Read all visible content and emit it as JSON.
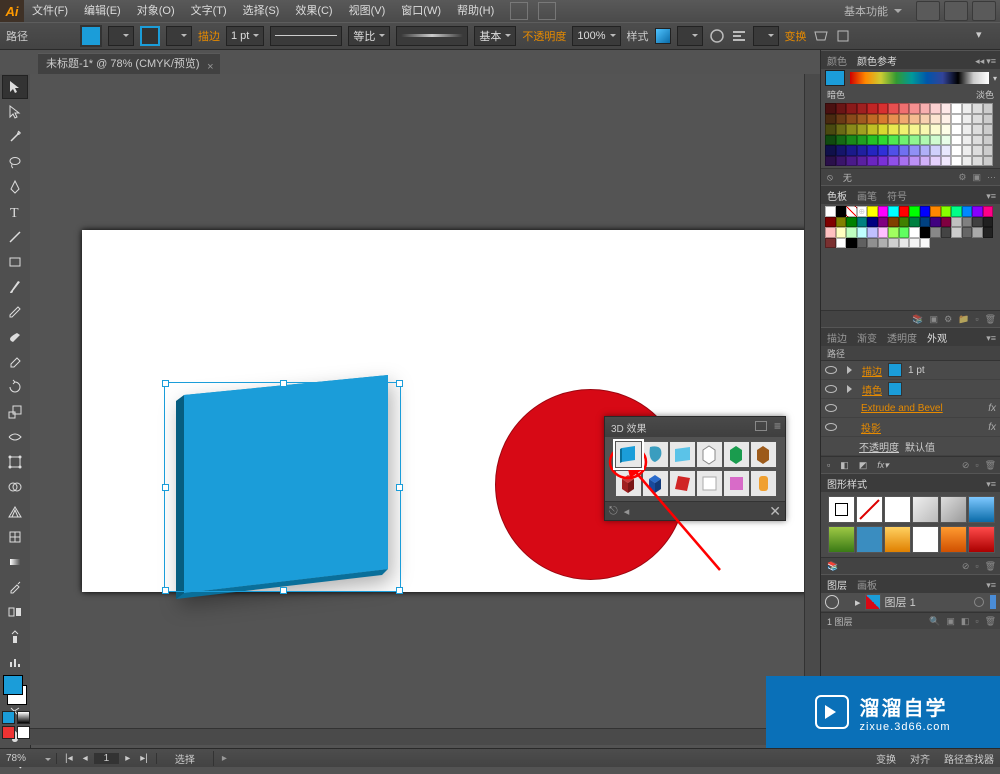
{
  "app": {
    "logo": "Ai"
  },
  "menu": [
    "文件(F)",
    "编辑(E)",
    "对象(O)",
    "文字(T)",
    "选择(S)",
    "效果(C)",
    "视图(V)",
    "窗口(W)",
    "帮助(H)"
  ],
  "workspace": "基本功能",
  "options": {
    "path_label": "路径",
    "stroke_label": "描边",
    "stroke_weight": "1 pt",
    "uniform": "等比",
    "profile": "基本",
    "opacity_label": "不透明度",
    "opacity": "100%",
    "style_label": "样式",
    "transform_label": "变换"
  },
  "doc_tab": "未标题-1* @ 78% (CMYK/预览)",
  "panels": {
    "color": {
      "tabs": [
        "颜色",
        "颜色参考"
      ],
      "warm": "暗色",
      "cool": "淡色",
      "none": "无"
    },
    "swatches": {
      "tabs": [
        "色板",
        "画笔",
        "符号"
      ]
    },
    "appearance": {
      "tabs": [
        "描边",
        "渐变",
        "透明度",
        "外观"
      ],
      "rows": [
        {
          "label": "描边",
          "value": "1 pt",
          "link": true,
          "chip": true
        },
        {
          "label": "填色",
          "value": "",
          "link": true,
          "chip": true
        },
        {
          "label": "Extrude and Bevel",
          "fx": true,
          "orange": true
        },
        {
          "label": "投影",
          "fx": true,
          "orange": true
        },
        {
          "label": "不透明度",
          "value": "默认值"
        }
      ]
    },
    "gstyles": {
      "tabs": [
        "图形样式"
      ]
    },
    "layers": {
      "tabs": [
        "图层",
        "画板"
      ],
      "layer_name": "图层 1",
      "count": "1 图层"
    }
  },
  "fx_panel": {
    "title": "3D 效果"
  },
  "status": {
    "zoom": "78%",
    "page": "1",
    "section1": "选择",
    "right": [
      "变换",
      "对齐",
      "路径查找器"
    ]
  },
  "watermark": {
    "cn": "溜溜自学",
    "url": "zixue.3d66.com"
  }
}
